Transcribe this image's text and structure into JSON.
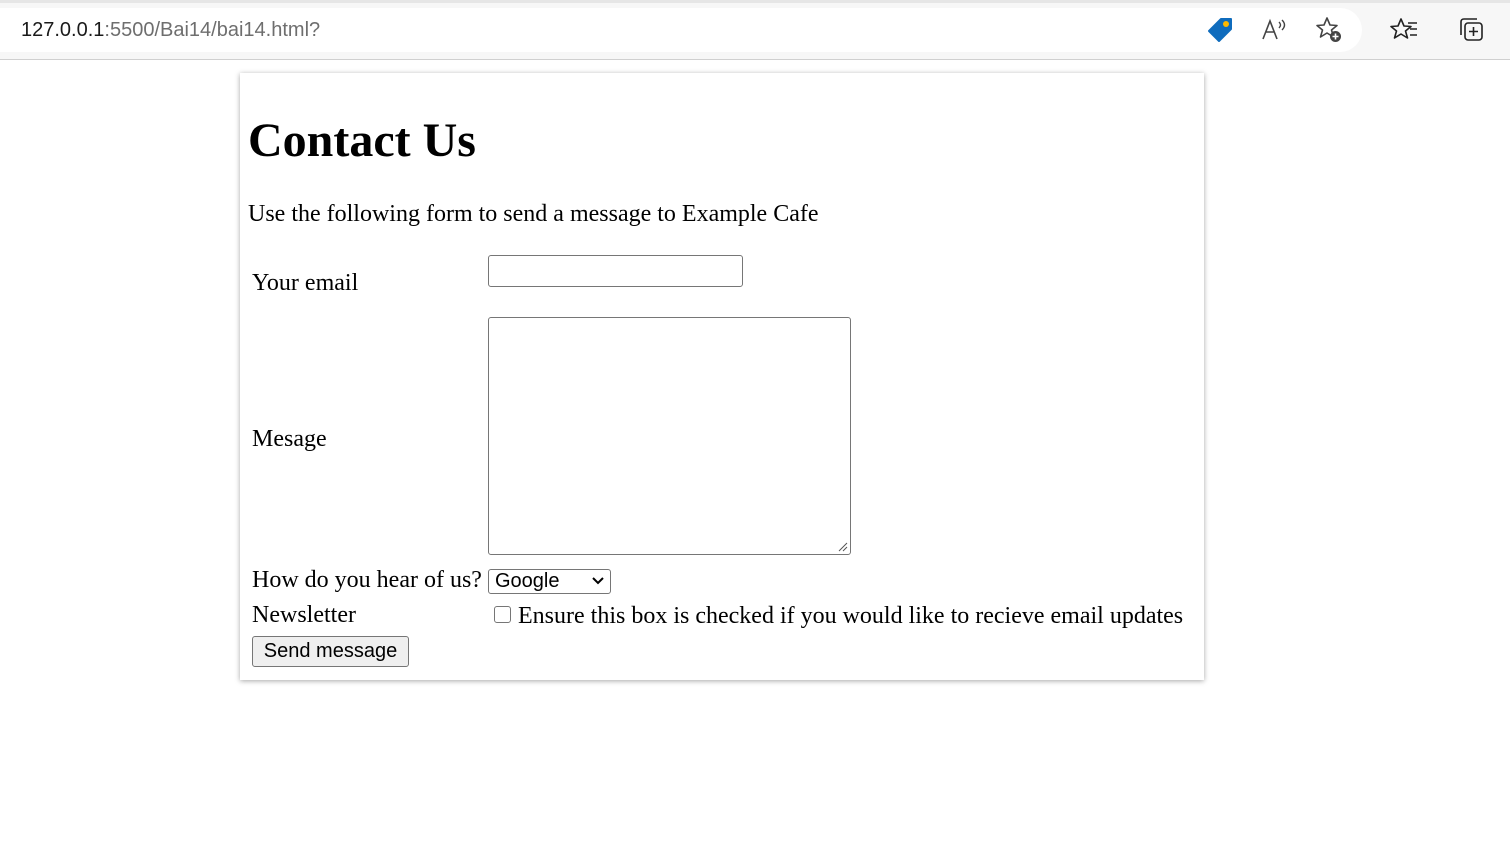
{
  "browser": {
    "url_host": "127.0.0.1",
    "url_rest": ":5500/Bai14/bai14.html?",
    "icons": {
      "tag": "coupon-tag-icon",
      "read_aloud": "read-aloud-icon",
      "add_favorite": "add-favorite-icon",
      "favorites": "favorites-icon",
      "collections": "collections-icon"
    },
    "colors": {
      "tag_blue": "#0f6cbd",
      "tag_dot": "#ffb900"
    }
  },
  "page": {
    "title": "Contact Us",
    "intro": "Use the following form to send a message to Example Cafe"
  },
  "form": {
    "email_label": "Your email",
    "email_value": "",
    "message_label": "Mesage",
    "message_value": "",
    "hear_label": "How do you hear of us?",
    "hear_selected": "Google",
    "newsletter_label": "Newsletter",
    "newsletter_checked": false,
    "checkbox_text": "Ensure this box is checked if you would like to recieve email updates",
    "submit_label": "Send message"
  }
}
